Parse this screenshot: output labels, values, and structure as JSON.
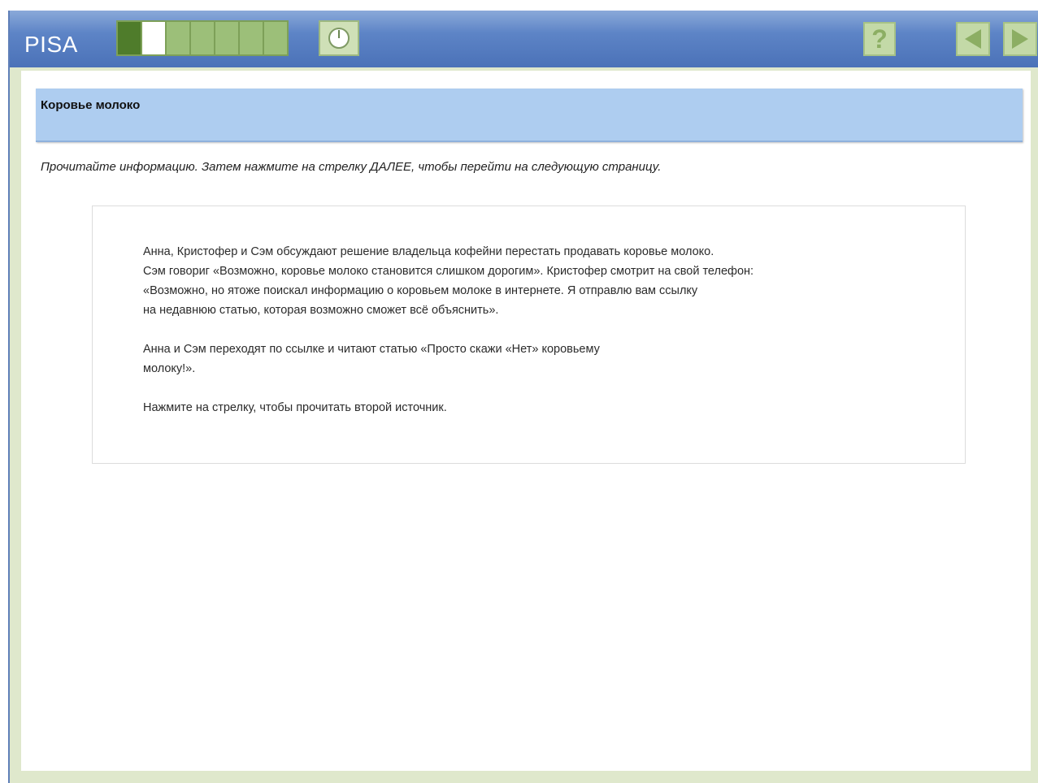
{
  "app": {
    "title": "PISA"
  },
  "progress": {
    "total_units": 7,
    "done_units": 1,
    "current_index": 1
  },
  "toolbar": {
    "help_label": "?",
    "colors": {
      "bar": "#4b72b8",
      "button": "#c3d9a7",
      "button_glyph": "#8cae63"
    }
  },
  "unit": {
    "title": "Коровье молоко"
  },
  "instruction": "Прочитайте информацию. Затем нажмите на стрелку ДАЛЕЕ, чтобы перейти на следующую страницу.",
  "stimulus": {
    "paragraph1": {
      "line1": "Анна, Кристофер и Сэм обсуждают решение владельца кофейни перестать продавать коровье молоко.",
      "line2": "Сэм говориг «Возможно, коровье молоко становится слишком дорогим». Кристофер смотрит на свой телефон:",
      "line3": "«Возможно, но ятоже поискал информацию о коровьем молоке в интернете. Я отправлю вам ссылку",
      "line4": "на недавнюю статью, которая возможно сможет всё объяснить»."
    },
    "paragraph2": {
      "line1": "Анна и Сэм переходят по ссылке и читают статью «Просто скажи «Нет» коровьему",
      "line2": "молоку!»."
    },
    "paragraph3": {
      "line1": "Нажмите на стрелку, чтобы прочитать второй источник."
    }
  }
}
